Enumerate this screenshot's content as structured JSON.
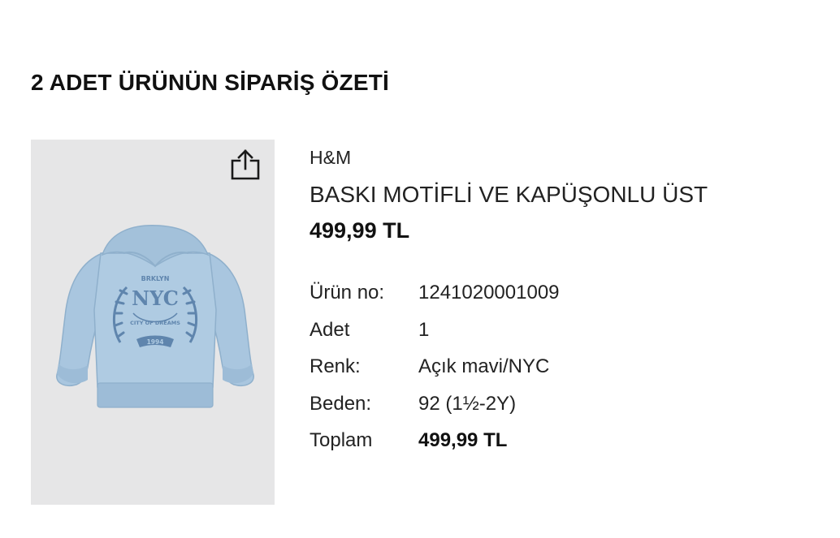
{
  "summary": {
    "title": "2 ADET ÜRÜNÜN SİPARİŞ ÖZETİ"
  },
  "product": {
    "brand": "H&M",
    "name": "BASKI MOTİFLİ VE KAPÜŞONLU ÜST",
    "price": "499,99 TL",
    "image_icon": "share-icon",
    "details": {
      "product_no_label": "Ürün no:",
      "product_no_value": "1241020001009",
      "quantity_label": "Adet",
      "quantity_value": "1",
      "color_label": "Renk:",
      "color_value": "Açık mavi/NYC",
      "size_label": "Beden:",
      "size_value": "92 (1½-2Y)",
      "total_label": "Toplam",
      "total_value": "499,99 TL"
    }
  },
  "colors": {
    "image_background": "#e6e6e7",
    "hoodie": "#a9c6df",
    "hoodie_print": "#5f85ad"
  }
}
